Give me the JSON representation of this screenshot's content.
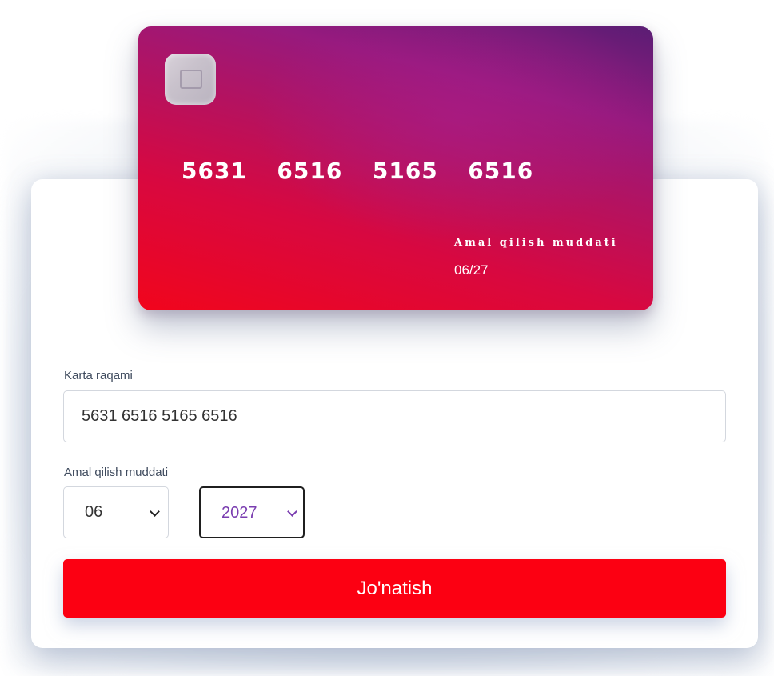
{
  "card": {
    "number": "5631  6516  5165  6516",
    "expiry_label": "Amal qilish muddati",
    "expiry_value": "06/27",
    "chip_icon": "card-chip-icon"
  },
  "form": {
    "number_label": "Karta raqami",
    "number_value": "5631 6516 5165 6516",
    "expiry_label": "Amal qilish muddati",
    "month_selected": "06",
    "year_selected": "2027",
    "submit_label": "Jo'natish"
  },
  "colors": {
    "submit_button": "#fc0012",
    "card_gradient_start": "#f1051c",
    "card_gradient_end": "#5a1d74",
    "year_text": "#7a3db0"
  }
}
